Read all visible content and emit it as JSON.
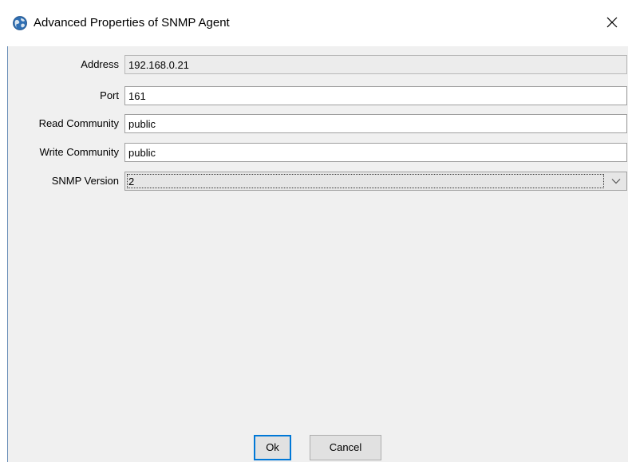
{
  "window": {
    "title": "Advanced Properties of SNMP Agent",
    "icon": "globe-icon",
    "close_icon": "close-icon"
  },
  "form": {
    "address": {
      "label": "Address",
      "value": "192.168.0.21",
      "readonly": true
    },
    "port": {
      "label": "Port",
      "value": "161"
    },
    "read_community": {
      "label": "Read Community",
      "value": "public"
    },
    "write_community": {
      "label": "Write Community",
      "value": "public"
    },
    "snmp_version": {
      "label": "SNMP Version",
      "selected": "2",
      "icon": "chevron-down-icon"
    }
  },
  "buttons": {
    "ok_label": "Ok",
    "cancel_label": "Cancel"
  },
  "colors": {
    "panel_background": "#f0f0f0",
    "accent_border": "#0078d7",
    "left_edge": "#6a8fb8"
  }
}
